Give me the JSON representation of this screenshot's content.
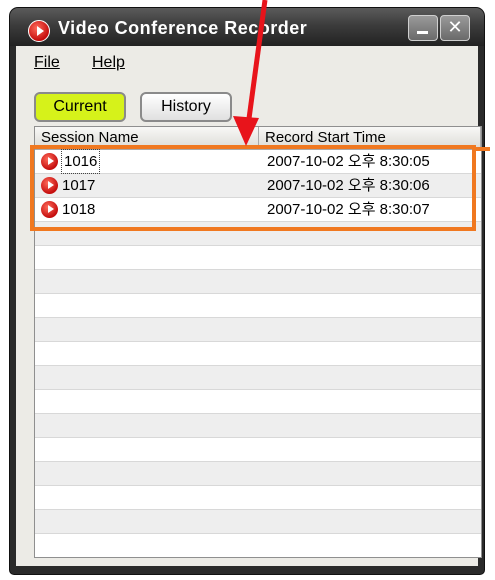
{
  "window": {
    "title": "Video Conference Recorder",
    "close_glyph": "✕"
  },
  "menu": {
    "file": "File",
    "help": "Help"
  },
  "tabs": {
    "current": "Current",
    "history": "History",
    "active": "Current"
  },
  "list": {
    "columns": [
      "Session Name",
      "Record Start Time"
    ],
    "rows": [
      {
        "name": "1016",
        "start": "2007-10-02 오후 8:30:05",
        "icon": "record-icon"
      },
      {
        "name": "1017",
        "start": "2007-10-02 오후 8:30:06",
        "icon": "record-icon"
      },
      {
        "name": "1018",
        "start": "2007-10-02 오후 8:30:07",
        "icon": "record-icon"
      }
    ],
    "empty_row_count": 16
  },
  "colors": {
    "accent_tab": "#d6f21a",
    "annotation_box": "#f07820",
    "annotation_arrow": "#e8141b",
    "record_icon": "#c40d0d"
  }
}
